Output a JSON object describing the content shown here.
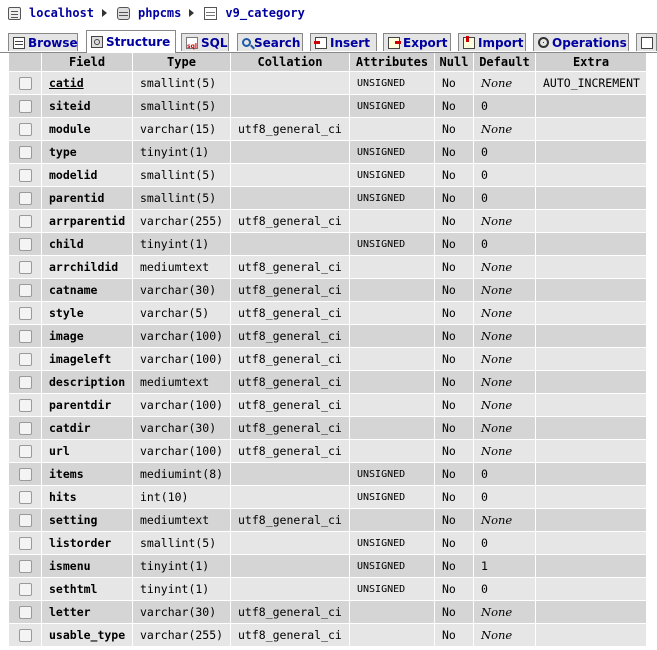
{
  "breadcrumb": {
    "server": "localhost",
    "database": "phpcms",
    "table": "v9_category"
  },
  "tabs": [
    {
      "label": "Browse",
      "icon": "browse-icon"
    },
    {
      "label": "Structure",
      "icon": "structure-icon",
      "active": true
    },
    {
      "label": "SQL",
      "icon": "sql-icon"
    },
    {
      "label": "Search",
      "icon": "search-icon"
    },
    {
      "label": "Insert",
      "icon": "insert-icon"
    },
    {
      "label": "Export",
      "icon": "export-icon"
    },
    {
      "label": "Import",
      "icon": "import-icon"
    },
    {
      "label": "Operations",
      "icon": "operations-icon"
    },
    {
      "label": "",
      "icon": "empty-icon"
    }
  ],
  "table": {
    "headers": [
      "",
      "Field",
      "Type",
      "Collation",
      "Attributes",
      "Null",
      "Default",
      "Extra"
    ],
    "rows": [
      {
        "field": "catid",
        "type": "smallint(5)",
        "collation": "",
        "attributes": "UNSIGNED",
        "null": "No",
        "default": "None",
        "extra": "AUTO_INCREMENT",
        "primary": true
      },
      {
        "field": "siteid",
        "type": "smallint(5)",
        "collation": "",
        "attributes": "UNSIGNED",
        "null": "No",
        "default": "0",
        "extra": ""
      },
      {
        "field": "module",
        "type": "varchar(15)",
        "collation": "utf8_general_ci",
        "attributes": "",
        "null": "No",
        "default": "None",
        "extra": ""
      },
      {
        "field": "type",
        "type": "tinyint(1)",
        "collation": "",
        "attributes": "UNSIGNED",
        "null": "No",
        "default": "0",
        "extra": ""
      },
      {
        "field": "modelid",
        "type": "smallint(5)",
        "collation": "",
        "attributes": "UNSIGNED",
        "null": "No",
        "default": "0",
        "extra": ""
      },
      {
        "field": "parentid",
        "type": "smallint(5)",
        "collation": "",
        "attributes": "UNSIGNED",
        "null": "No",
        "default": "0",
        "extra": ""
      },
      {
        "field": "arrparentid",
        "type": "varchar(255)",
        "collation": "utf8_general_ci",
        "attributes": "",
        "null": "No",
        "default": "None",
        "extra": ""
      },
      {
        "field": "child",
        "type": "tinyint(1)",
        "collation": "",
        "attributes": "UNSIGNED",
        "null": "No",
        "default": "0",
        "extra": ""
      },
      {
        "field": "arrchildid",
        "type": "mediumtext",
        "collation": "utf8_general_ci",
        "attributes": "",
        "null": "No",
        "default": "None",
        "extra": ""
      },
      {
        "field": "catname",
        "type": "varchar(30)",
        "collation": "utf8_general_ci",
        "attributes": "",
        "null": "No",
        "default": "None",
        "extra": ""
      },
      {
        "field": "style",
        "type": "varchar(5)",
        "collation": "utf8_general_ci",
        "attributes": "",
        "null": "No",
        "default": "None",
        "extra": ""
      },
      {
        "field": "image",
        "type": "varchar(100)",
        "collation": "utf8_general_ci",
        "attributes": "",
        "null": "No",
        "default": "None",
        "extra": ""
      },
      {
        "field": "imageleft",
        "type": "varchar(100)",
        "collation": "utf8_general_ci",
        "attributes": "",
        "null": "No",
        "default": "None",
        "extra": ""
      },
      {
        "field": "description",
        "type": "mediumtext",
        "collation": "utf8_general_ci",
        "attributes": "",
        "null": "No",
        "default": "None",
        "extra": ""
      },
      {
        "field": "parentdir",
        "type": "varchar(100)",
        "collation": "utf8_general_ci",
        "attributes": "",
        "null": "No",
        "default": "None",
        "extra": ""
      },
      {
        "field": "catdir",
        "type": "varchar(30)",
        "collation": "utf8_general_ci",
        "attributes": "",
        "null": "No",
        "default": "None",
        "extra": ""
      },
      {
        "field": "url",
        "type": "varchar(100)",
        "collation": "utf8_general_ci",
        "attributes": "",
        "null": "No",
        "default": "None",
        "extra": ""
      },
      {
        "field": "items",
        "type": "mediumint(8)",
        "collation": "",
        "attributes": "UNSIGNED",
        "null": "No",
        "default": "0",
        "extra": ""
      },
      {
        "field": "hits",
        "type": "int(10)",
        "collation": "",
        "attributes": "UNSIGNED",
        "null": "No",
        "default": "0",
        "extra": ""
      },
      {
        "field": "setting",
        "type": "mediumtext",
        "collation": "utf8_general_ci",
        "attributes": "",
        "null": "No",
        "default": "None",
        "extra": ""
      },
      {
        "field": "listorder",
        "type": "smallint(5)",
        "collation": "",
        "attributes": "UNSIGNED",
        "null": "No",
        "default": "0",
        "extra": ""
      },
      {
        "field": "ismenu",
        "type": "tinyint(1)",
        "collation": "",
        "attributes": "UNSIGNED",
        "null": "No",
        "default": "1",
        "extra": ""
      },
      {
        "field": "sethtml",
        "type": "tinyint(1)",
        "collation": "",
        "attributes": "UNSIGNED",
        "null": "No",
        "default": "0",
        "extra": ""
      },
      {
        "field": "letter",
        "type": "varchar(30)",
        "collation": "utf8_general_ci",
        "attributes": "",
        "null": "No",
        "default": "None",
        "extra": ""
      },
      {
        "field": "usable_type",
        "type": "varchar(255)",
        "collation": "utf8_general_ci",
        "attributes": "",
        "null": "No",
        "default": "None",
        "extra": ""
      }
    ]
  },
  "colors": {
    "link": "#0000a0",
    "header_bg": "#d0d0d0",
    "row_odd": "#e6e6e6",
    "row_even": "#d5d5d5"
  }
}
